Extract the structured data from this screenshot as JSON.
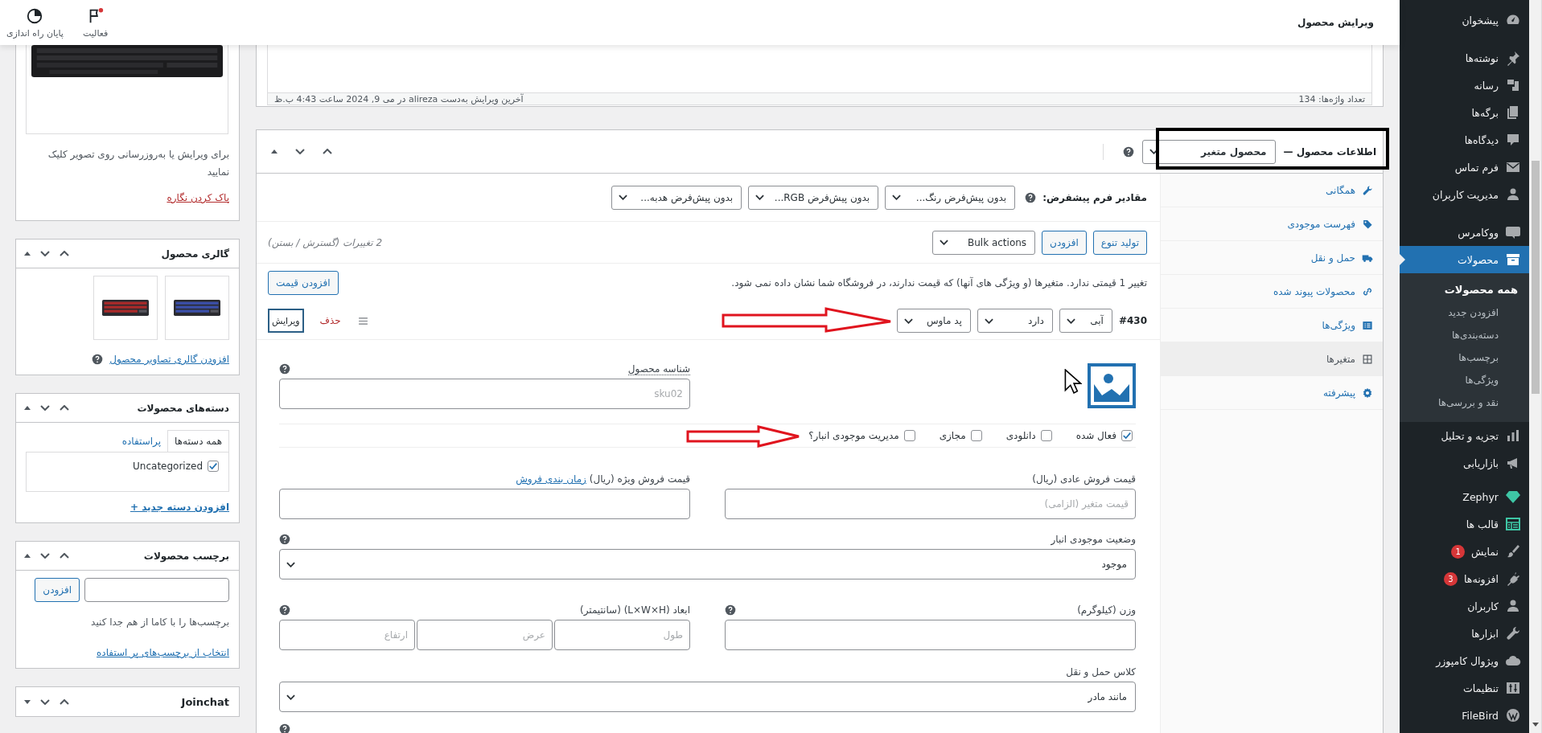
{
  "topbar": {
    "title": "ویرایش محصول",
    "actions": [
      {
        "label": "فعالیت",
        "kind": "activity",
        "alert": true
      },
      {
        "label": "پایان راه اندازی",
        "kind": "setup",
        "alert": false
      }
    ]
  },
  "admin_menu": {
    "groups": [
      {
        "items": [
          {
            "label": "پیشخوان",
            "selected": false
          }
        ]
      },
      {
        "items": [
          {
            "label": "نوشته‌ها",
            "selected": false
          },
          {
            "label": "رسانه",
            "selected": false
          },
          {
            "label": "برگه‌ها",
            "selected": false
          },
          {
            "label": "دیدگاه‌ها",
            "selected": false
          },
          {
            "label": "فرم تماس",
            "selected": false
          },
          {
            "label": "مدیریت کاربران",
            "selected": false
          }
        ]
      },
      {
        "items": [
          {
            "label": "ووکامرس",
            "selected": false
          },
          {
            "label": "محصولات",
            "selected": true,
            "children": [
              {
                "label": "همه محصولات",
                "selected": true
              },
              {
                "label": "افزودن جدید",
                "selected": false
              },
              {
                "label": "دسته‌بندی‌ها",
                "selected": false
              },
              {
                "label": "برچسب‌ها",
                "selected": false
              },
              {
                "label": "ویژگی‌ها",
                "selected": false
              },
              {
                "label": "نقد و بررسی‌ها",
                "selected": false
              }
            ]
          },
          {
            "label": "تجزیه و تحلیل",
            "selected": false
          },
          {
            "label": "بازاریابی",
            "selected": false
          }
        ]
      },
      {
        "items": [
          {
            "label": "Zephyr",
            "selected": false
          },
          {
            "label": "قالب ها",
            "selected": false
          },
          {
            "label": "نمایش",
            "selected": false,
            "badge": "1"
          },
          {
            "label": "افزونه‌ها",
            "selected": false,
            "badge": "3"
          },
          {
            "label": "کاربران",
            "selected": false
          },
          {
            "label": "ابزارها",
            "selected": false
          },
          {
            "label": "ویژوال کامپوزر",
            "selected": false
          },
          {
            "label": "تنظیمات",
            "selected": false
          },
          {
            "label": "FileBird",
            "selected": false
          }
        ]
      }
    ]
  },
  "editor": {
    "word_count": "تعداد واژه‌ها: 134",
    "last_edit": "آخرین ویرایش به‌دست alireza در می 9, 2024 ساعت 4:43 ب.ظ"
  },
  "product_data": {
    "title": "اطلاعات محصول —",
    "product_type": "محصول متغیر",
    "tabs": [
      {
        "label": "همگانی",
        "selected": false
      },
      {
        "label": "فهرست موجودی",
        "selected": false
      },
      {
        "label": "حمل و نقل",
        "selected": false
      },
      {
        "label": "محصولات پیوند شده",
        "selected": false
      },
      {
        "label": "ویژگی‌ها",
        "selected": false
      },
      {
        "label": "متغیرها",
        "selected": true
      },
      {
        "label": "پیشرفته",
        "selected": false
      }
    ],
    "defaults_label": "مقادیر فرم پیشفرض:",
    "default_selects": [
      "بدون پیش‌فرض رنگ...",
      "بدون پیش‌فرض RGB...",
      "بدون پیش‌فرض هدبه..."
    ],
    "buttons": [
      "تولید تنوع",
      "افزودن"
    ],
    "bulk_actions": "Bulk actions",
    "variations_count": "2 تغییرات (گسترش / بستن)",
    "notice": "تغییر 1 قیمتی ندارد. متغیرها (و ویژگی های آنها) که قیمت ندارند، در فروشگاه شما نشان داده نمی شود.",
    "notice_button": "افزودن قیمت",
    "variation": {
      "number": "#430",
      "attributes": [
        "آبی",
        "دارد",
        "پد ماوس"
      ],
      "remove": "حذف",
      "edit": "ویرایش",
      "sku": {
        "label": "شناسه محصول",
        "placeholder": "sku02"
      },
      "options": [
        {
          "label": "فعال شده",
          "checked": true
        },
        {
          "label": "دانلودی",
          "checked": false
        },
        {
          "label": "مجازی",
          "checked": false
        },
        {
          "label": "مدیریت موجودی انبار؟",
          "checked": false
        }
      ],
      "regular_price": {
        "label": "قیمت فروش عادی (ریال)",
        "placeholder": "قیمت متغیر (الزامی)"
      },
      "sale_price": {
        "label": "قیمت فروش ویژه (ریال)",
        "link": "زمان بندی فروش"
      },
      "stock_status": {
        "label": "وضعیت موجودی انبار",
        "value": "موجود"
      },
      "weight": {
        "label": "وزن (کیلوگرم)"
      },
      "dimensions": {
        "label": "ابعاد (L×W×H) (سانتیمتر)",
        "placeholders": [
          "طول",
          "عرض",
          "ارتفاع"
        ]
      },
      "shipping_class": {
        "label": "کلاس حمل و نقل",
        "value": "مانند مادر"
      }
    }
  },
  "side_boxes": {
    "image": {
      "hint": "برای ویرایش یا به‌روزرسانی روی تصویر کلیک نمایید",
      "remove_link": "پاک کردن نگاره"
    },
    "gallery": {
      "title": "گالری محصول",
      "add_link": "افزودن گالری تصاویر محصول"
    },
    "categories": {
      "title": "دسته‌های محصولات",
      "tabs": [
        {
          "label": "همه دسته‌ها",
          "selected": true
        },
        {
          "label": "پراستفاده",
          "selected": false
        }
      ],
      "items": [
        {
          "label": "Uncategorized",
          "checked": true
        }
      ],
      "add_link": "افزودن دسته جدید +"
    },
    "tags": {
      "title": "برچسب محصولات",
      "button": "افزودن",
      "hint": "برچسب‌ها را با کاما از هم جدا کنید",
      "link": "انتخاب از برچسب‌های پر استفاده"
    },
    "joinchat": {
      "title": "Joinchat"
    }
  }
}
